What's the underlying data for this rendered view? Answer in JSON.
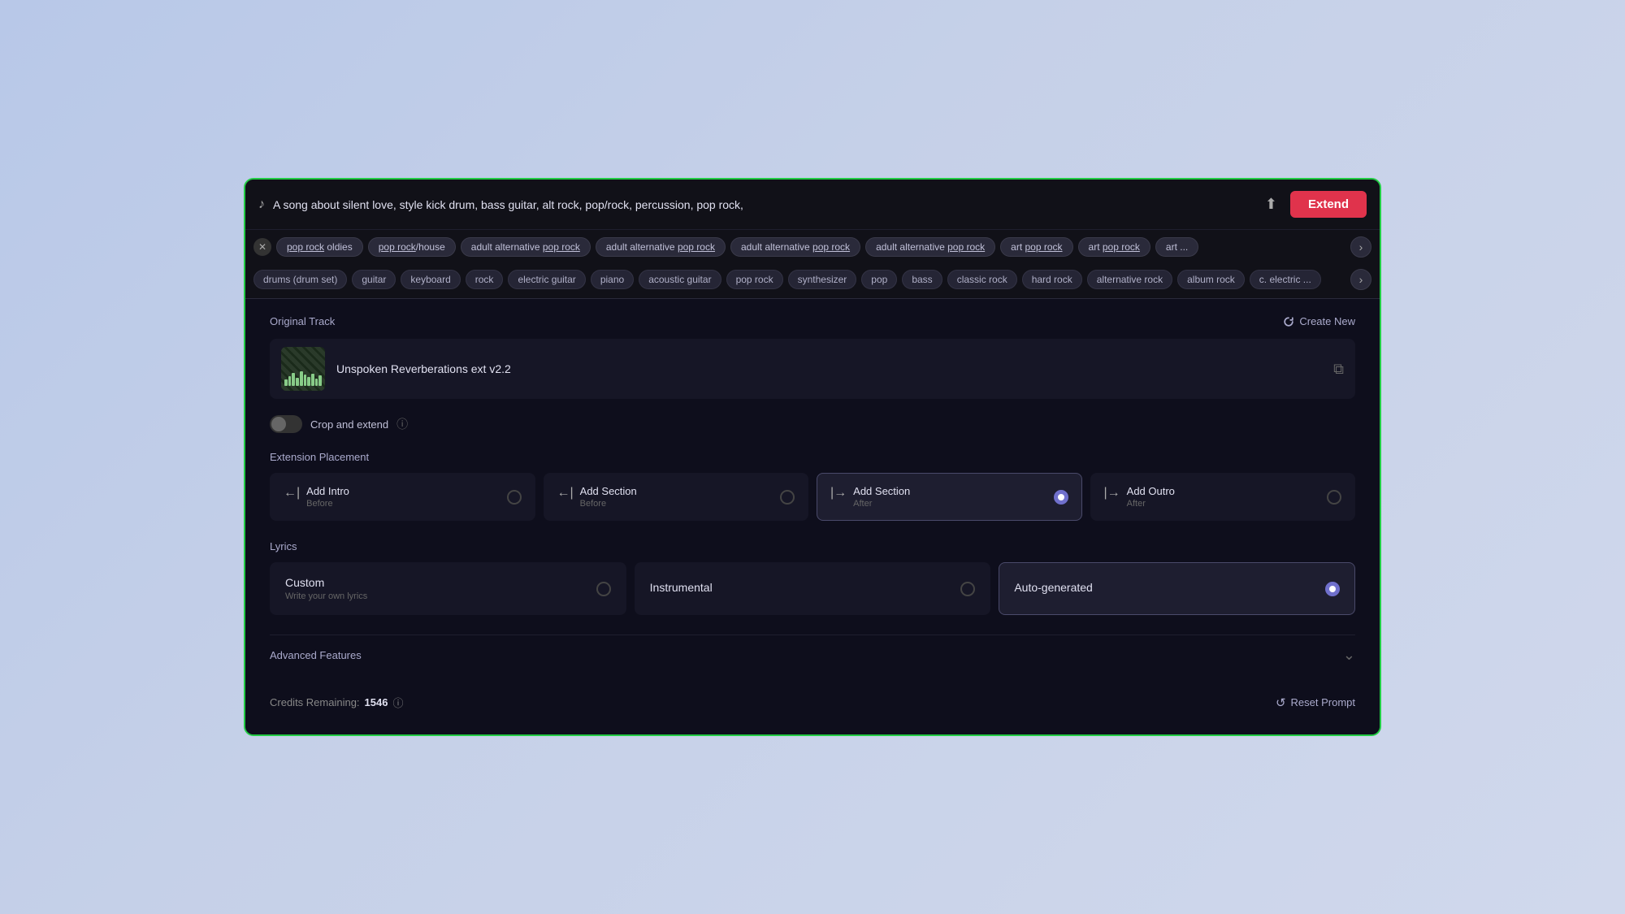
{
  "prompt": {
    "text": "A song about silent love, style kick drum, bass guitar, alt rock, pop/rock, percussion, pop rock,",
    "extend_label": "Extend"
  },
  "tags_row1": [
    {
      "label": "pop rock oldies",
      "underline_part": "pop rock"
    },
    {
      "label": "pop rock/house",
      "underline_part": "pop rock"
    },
    {
      "label": "adult alternative pop rock",
      "underline_part": "pop rock"
    },
    {
      "label": "adult alternative pop rock",
      "underline_part": "pop rock"
    },
    {
      "label": "adult alternative pop rock",
      "underline_part": "pop rock"
    },
    {
      "label": "adult alternative pop rock",
      "underline_part": "pop rock"
    },
    {
      "label": "art pop rock",
      "underline_part": "pop rock"
    },
    {
      "label": "art pop rock",
      "underline_part": "pop rock"
    },
    {
      "label": "art ...",
      "underline_part": "art"
    }
  ],
  "tags_row2": [
    "drums (drum set)",
    "guitar",
    "keyboard",
    "rock",
    "electric guitar",
    "piano",
    "acoustic guitar",
    "pop rock",
    "synthesizer",
    "pop",
    "bass",
    "classic rock",
    "hard rock",
    "alternative rock",
    "album rock",
    "c. electric ..."
  ],
  "original_track": {
    "title": "Original Track",
    "create_new_label": "Create New",
    "track_name": "Unspoken Reverberations ext v2.2"
  },
  "crop_extend": {
    "label": "Crop and extend"
  },
  "extension_placement": {
    "title": "Extension Placement",
    "options": [
      {
        "name": "Add Intro",
        "sub": "Before",
        "icon": "←|",
        "selected": false
      },
      {
        "name": "Add Section",
        "sub": "Before",
        "icon": "←|",
        "selected": false
      },
      {
        "name": "Add Section",
        "sub": "After",
        "icon": "|→",
        "selected": true
      },
      {
        "name": "Add Outro",
        "sub": "After",
        "icon": "|→",
        "selected": false
      }
    ]
  },
  "lyrics": {
    "title": "Lyrics",
    "options": [
      {
        "name": "Custom",
        "sub": "Write your own lyrics",
        "selected": false
      },
      {
        "name": "Instrumental",
        "sub": "",
        "selected": false
      },
      {
        "name": "Auto-generated",
        "sub": "",
        "selected": true
      }
    ]
  },
  "advanced": {
    "label": "Advanced Features"
  },
  "footer": {
    "credits_label": "Credits Remaining:",
    "credits_value": "1546",
    "reset_label": "Reset Prompt"
  }
}
